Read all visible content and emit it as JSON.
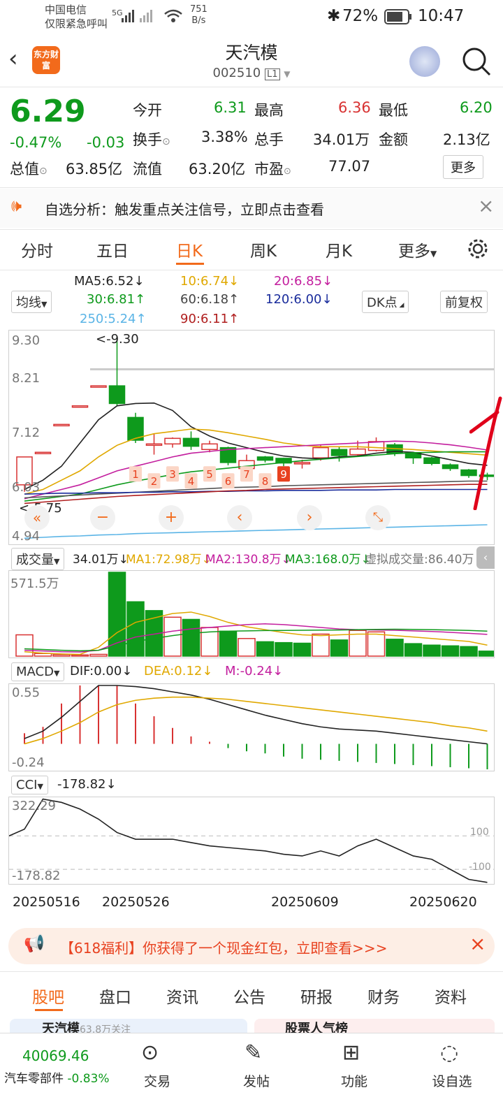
{
  "status": {
    "carrier1": "中国电信",
    "carrier2": "仅限紧急呼叫",
    "net_speed": "751",
    "net_unit": "B/s",
    "signal": "5G",
    "battery": "72%",
    "time": "10:47"
  },
  "header": {
    "logo": "东方财富",
    "title": "天汽模",
    "code": "002510",
    "level": "L1"
  },
  "quote": {
    "price": "6.29",
    "change_pct": "-0.47%",
    "change": "-0.03",
    "open_label": "今开",
    "open": "6.31",
    "high_label": "最高",
    "high": "6.36",
    "low_label": "最低",
    "low": "6.20",
    "turnover_label": "换手",
    "turnover": "3.38%",
    "volume_label": "总手",
    "volume": "34.01万",
    "amount_label": "金额",
    "amount": "2.13亿",
    "mcap_label": "总值",
    "mcap": "63.85亿",
    "float_label": "流值",
    "float": "63.20亿",
    "pe_label": "市盈",
    "pe": "77.07",
    "more": "更多"
  },
  "notice": {
    "text": "自选分析：触发重点关注信号，立即点击查看"
  },
  "tabs": [
    "分时",
    "五日",
    "日K",
    "周K",
    "月K",
    "更多"
  ],
  "active_tab": "日K",
  "ma": {
    "ma5": "MA5:6.52",
    "ma10": "10:6.74",
    "ma20": "20:6.85",
    "ma30": "30:6.81",
    "ma60": "60:6.18",
    "ma120": "120:6.00",
    "ma250": "250:5.24",
    "ma90": "90:6.11",
    "btn_ma": "均线",
    "btn_dk": "DK点",
    "btn_adj": "前复权"
  },
  "kline": {
    "y_labels": [
      "9.30",
      "8.21",
      "7.12",
      "6.03",
      "4.94"
    ],
    "max_label": "<-9.30",
    "min_label": "<-5.75",
    "seq": [
      "1",
      "2",
      "3",
      "4",
      "5",
      "6",
      "7",
      "8",
      "9"
    ]
  },
  "volume": {
    "label": "成交量",
    "cur": "34.01万",
    "ma1": "MA1:72.98万",
    "ma2": "MA2:130.8万",
    "ma3": "MA3:168.0万",
    "virtual": "虚拟成交量:86.40万",
    "ymax": "571.5万"
  },
  "macd": {
    "label": "MACD",
    "dif": "DIF:0.00",
    "dea": "DEA:0.12",
    "m": "M:-0.24",
    "ymax": "0.55",
    "ymin": "-0.24"
  },
  "cci": {
    "label": "CCI",
    "val": "-178.82",
    "ymax": "322.29",
    "ymin": "-178.82",
    "l100": "100",
    "lm100": "-100"
  },
  "dates": [
    "20250516",
    "20250526",
    "20250609",
    "20250620"
  ],
  "promo": {
    "text": "【618福利】你获得了一个现金红包，立即查看>>>"
  },
  "bottom_tabs": [
    "股吧",
    "盘口",
    "资讯",
    "公告",
    "研报",
    "财务",
    "资料"
  ],
  "peek": {
    "left": "天汽模",
    "left_sub": "63.8万关注",
    "right": "股票人气榜"
  },
  "nav": {
    "index": "40069.46",
    "sector": "汽车零部件",
    "sector_chg": "-0.83%",
    "trade": "交易",
    "post": "发帖",
    "func": "功能",
    "fav": "设自选"
  },
  "colors": {
    "up": "#d83232",
    "down": "#0e9a1c",
    "accent": "#f26a1b"
  },
  "candles": [
    {
      "o": 6.1,
      "c": 6.7,
      "h": 6.7,
      "l": 5.95
    },
    {
      "o": 6.8,
      "c": 6.8,
      "h": 6.8,
      "l": 6.8
    },
    {
      "o": 7.4,
      "c": 7.4,
      "h": 7.4,
      "l": 7.4
    },
    {
      "o": 7.8,
      "c": 7.8,
      "h": 7.8,
      "l": 7.8
    },
    {
      "o": 8.23,
      "c": 8.23,
      "h": 8.23,
      "l": 8.23
    },
    {
      "o": 8.23,
      "c": 7.85,
      "h": 9.3,
      "l": 7.8
    },
    {
      "o": 7.55,
      "c": 7.06,
      "h": 7.65,
      "l": 7.0
    },
    {
      "o": 6.98,
      "c": 6.98,
      "h": 7.2,
      "l": 6.75
    },
    {
      "o": 6.98,
      "c": 7.1,
      "h": 7.12,
      "l": 6.9
    },
    {
      "o": 7.1,
      "c": 6.93,
      "h": 7.25,
      "l": 6.85
    },
    {
      "o": 6.86,
      "c": 6.98,
      "h": 7.05,
      "l": 6.8
    },
    {
      "o": 6.9,
      "c": 6.58,
      "h": 6.92,
      "l": 6.52
    },
    {
      "o": 6.45,
      "c": 6.62,
      "h": 6.75,
      "l": 6.42
    },
    {
      "o": 6.7,
      "c": 6.63,
      "h": 6.72,
      "l": 6.58
    },
    {
      "o": 6.67,
      "c": 6.57,
      "h": 6.68,
      "l": 6.5
    },
    {
      "o": 6.55,
      "c": 6.58,
      "h": 6.64,
      "l": 6.45
    },
    {
      "o": 6.68,
      "c": 6.9,
      "h": 6.95,
      "l": 6.62
    },
    {
      "o": 6.86,
      "c": 6.73,
      "h": 6.92,
      "l": 6.6
    },
    {
      "o": 6.75,
      "c": 6.87,
      "h": 7.05,
      "l": 6.7
    },
    {
      "o": 6.84,
      "c": 7.03,
      "h": 7.12,
      "l": 6.82
    },
    {
      "o": 6.96,
      "c": 6.78,
      "h": 7.0,
      "l": 6.72
    },
    {
      "o": 6.78,
      "c": 6.68,
      "h": 6.8,
      "l": 6.55
    },
    {
      "o": 6.68,
      "c": 6.56,
      "h": 6.7,
      "l": 6.52
    },
    {
      "o": 6.53,
      "c": 6.45,
      "h": 6.56,
      "l": 6.4
    },
    {
      "o": 6.42,
      "c": 6.3,
      "h": 6.44,
      "l": 6.25
    },
    {
      "o": 6.31,
      "c": 6.29,
      "h": 6.36,
      "l": 6.2
    }
  ],
  "vol_bars": [
    {
      "v": 145,
      "up": true
    },
    {
      "v": 18,
      "up": true
    },
    {
      "v": 10,
      "up": true
    },
    {
      "v": 8,
      "up": true
    },
    {
      "v": 12,
      "up": true
    },
    {
      "v": 571,
      "up": false
    },
    {
      "v": 370,
      "up": false
    },
    {
      "v": 310,
      "up": false
    },
    {
      "v": 265,
      "up": true
    },
    {
      "v": 250,
      "up": false
    },
    {
      "v": 195,
      "up": true
    },
    {
      "v": 170,
      "up": false
    },
    {
      "v": 120,
      "up": true
    },
    {
      "v": 98,
      "up": false
    },
    {
      "v": 92,
      "up": false
    },
    {
      "v": 88,
      "up": false
    },
    {
      "v": 150,
      "up": true
    },
    {
      "v": 110,
      "up": false
    },
    {
      "v": 175,
      "up": true
    },
    {
      "v": 165,
      "up": true
    },
    {
      "v": 115,
      "up": false
    },
    {
      "v": 85,
      "up": false
    },
    {
      "v": 75,
      "up": false
    },
    {
      "v": 70,
      "up": false
    },
    {
      "v": 65,
      "up": false
    },
    {
      "v": 34,
      "up": false
    }
  ],
  "macd_bars": [
    0.1,
    0.16,
    0.38,
    0.55,
    0.55,
    0.55,
    0.38,
    0.26,
    0.15,
    0.07,
    0.02,
    -0.04,
    -0.07,
    -0.09,
    -0.12,
    -0.14,
    -0.15,
    -0.16,
    -0.17,
    -0.18,
    -0.19,
    -0.2,
    -0.21,
    -0.22,
    -0.23,
    -0.24
  ]
}
